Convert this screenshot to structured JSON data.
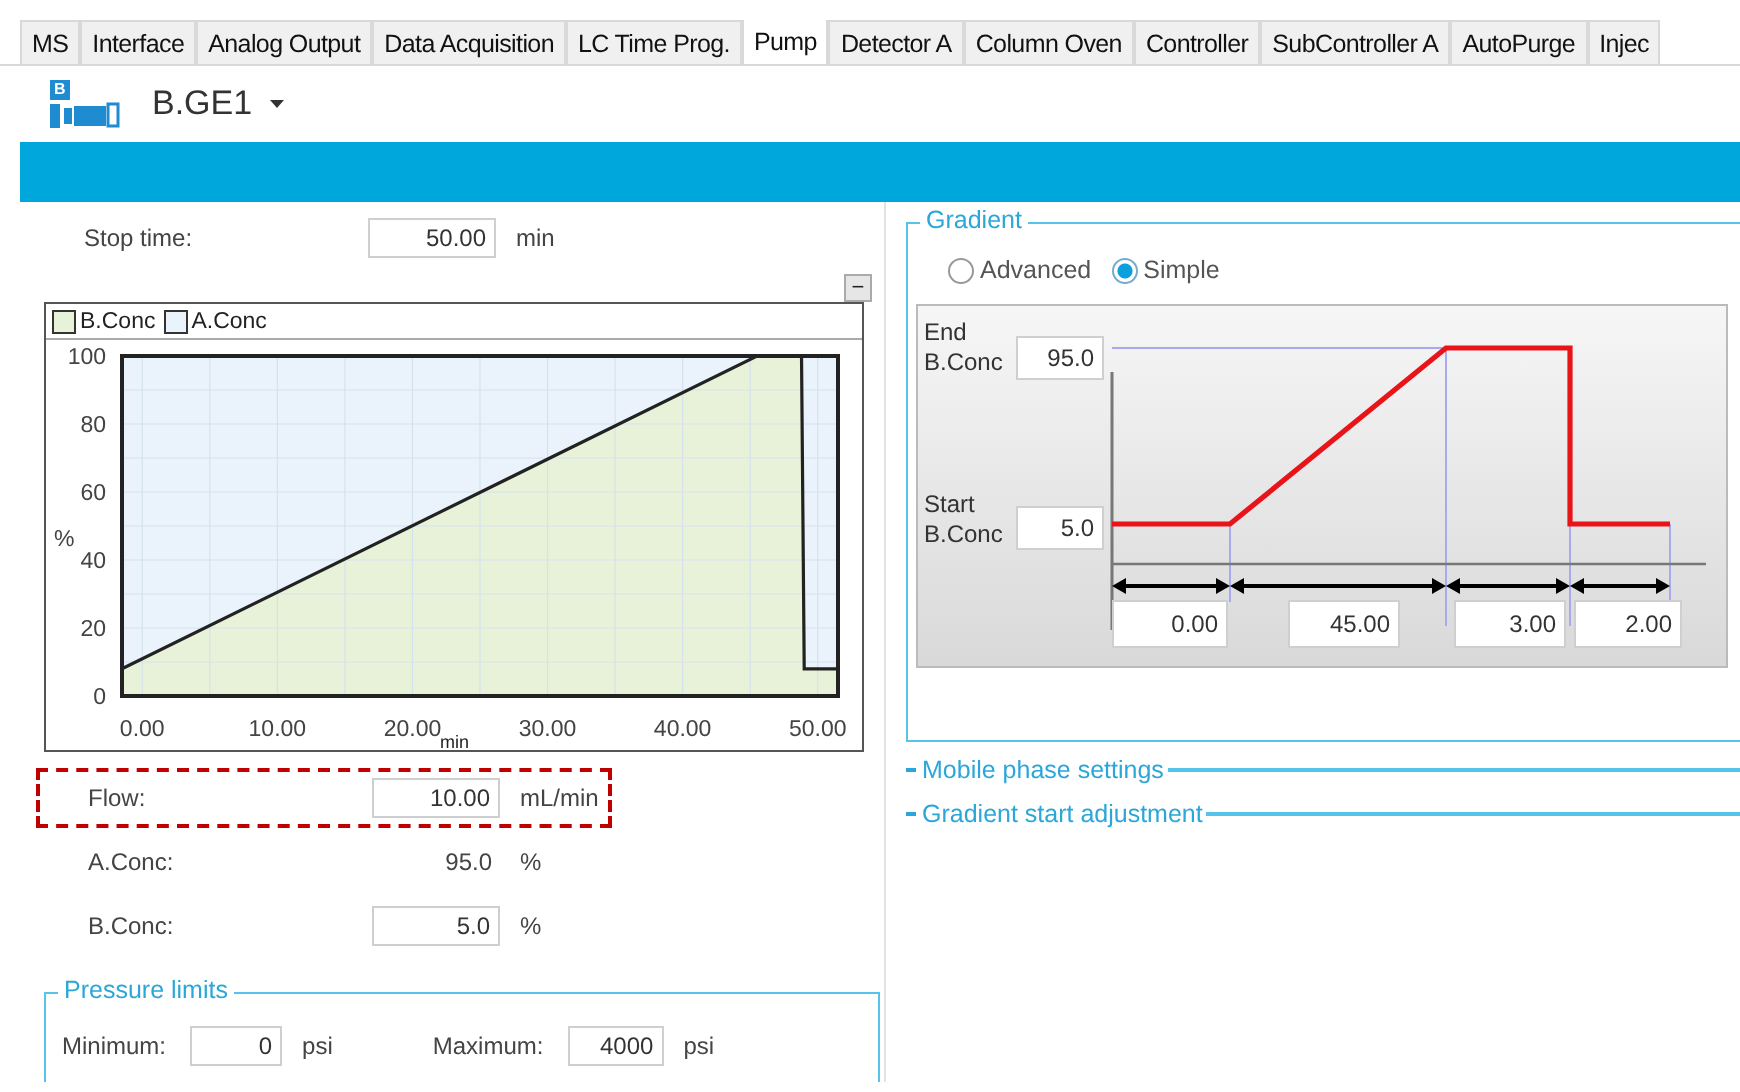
{
  "tabs": [
    {
      "label": "MS",
      "selected": false
    },
    {
      "label": "Interface",
      "selected": false
    },
    {
      "label": "Analog Output",
      "selected": false
    },
    {
      "label": "Data Acquisition",
      "selected": false
    },
    {
      "label": "LC Time Prog.",
      "selected": false
    },
    {
      "label": "Pump",
      "selected": true
    },
    {
      "label": "Detector A",
      "selected": false
    },
    {
      "label": "Column Oven",
      "selected": false
    },
    {
      "label": "Controller",
      "selected": false
    },
    {
      "label": "SubController A",
      "selected": false
    },
    {
      "label": "AutoPurge",
      "selected": false
    },
    {
      "label": "Injec",
      "selected": false
    }
  ],
  "device": {
    "name": "B.GE1",
    "badge": "B"
  },
  "stop_time": {
    "label": "Stop time:",
    "value": "50.00",
    "unit": "min"
  },
  "collapse_button": "−",
  "program_chart": {
    "chart_data": {
      "type": "area",
      "stacked": true,
      "grid": true,
      "xlabel": "min",
      "ylabel": "%",
      "x": [
        -1.5,
        45.5,
        48.8,
        49,
        51.5
      ],
      "series": [
        {
          "name": "B.Conc",
          "color": "#e8f2d8",
          "values": [
            8,
            100,
            100,
            8,
            8
          ]
        },
        {
          "name": "A.Conc",
          "color": "#eaf3fb",
          "values": [
            92,
            0,
            0,
            92,
            92
          ]
        }
      ],
      "xlim": [
        -1.5,
        51.5
      ],
      "ylim": [
        0,
        100
      ],
      "xticks": [
        {
          "value": 0,
          "label": "0.00"
        },
        {
          "value": 10,
          "label": "10.00"
        },
        {
          "value": 20,
          "label": "20.00"
        },
        {
          "value": 30,
          "label": "30.00"
        },
        {
          "value": 40,
          "label": "40.00"
        },
        {
          "value": 50,
          "label": "50.00"
        }
      ],
      "yticks": [
        0,
        20,
        40,
        60,
        80,
        100
      ]
    }
  },
  "settings": [
    {
      "kind": "input",
      "label": "Flow:",
      "value": "10.00",
      "unit": "mL/min",
      "highlighted": true
    },
    {
      "kind": "readonly",
      "label": "A.Conc:",
      "value": "95.0",
      "unit": "%",
      "highlighted": false
    },
    {
      "kind": "input",
      "label": "B.Conc:",
      "value": "5.0",
      "unit": "%",
      "highlighted": false
    }
  ],
  "pressure_limits": {
    "title": "Pressure limits",
    "fields": [
      {
        "label": "Minimum:",
        "value": "0",
        "unit": "psi"
      },
      {
        "label": "Maximum:",
        "value": "4000",
        "unit": "psi"
      }
    ]
  },
  "gradient": {
    "title": "Gradient",
    "modes": [
      {
        "label": "Advanced",
        "selected": false
      },
      {
        "label": "Simple",
        "selected": true
      }
    ],
    "end": {
      "label_1": "End",
      "label_2": "B.Conc",
      "value": "95.0"
    },
    "start": {
      "label_1": "Start",
      "label_2": "B.Conc",
      "value": "5.0"
    },
    "durations": [
      "0.00",
      "45.00",
      "3.00",
      "2.00"
    ]
  },
  "sections": [
    {
      "title": "Mobile phase settings"
    },
    {
      "title": "Gradient start adjustment"
    }
  ]
}
